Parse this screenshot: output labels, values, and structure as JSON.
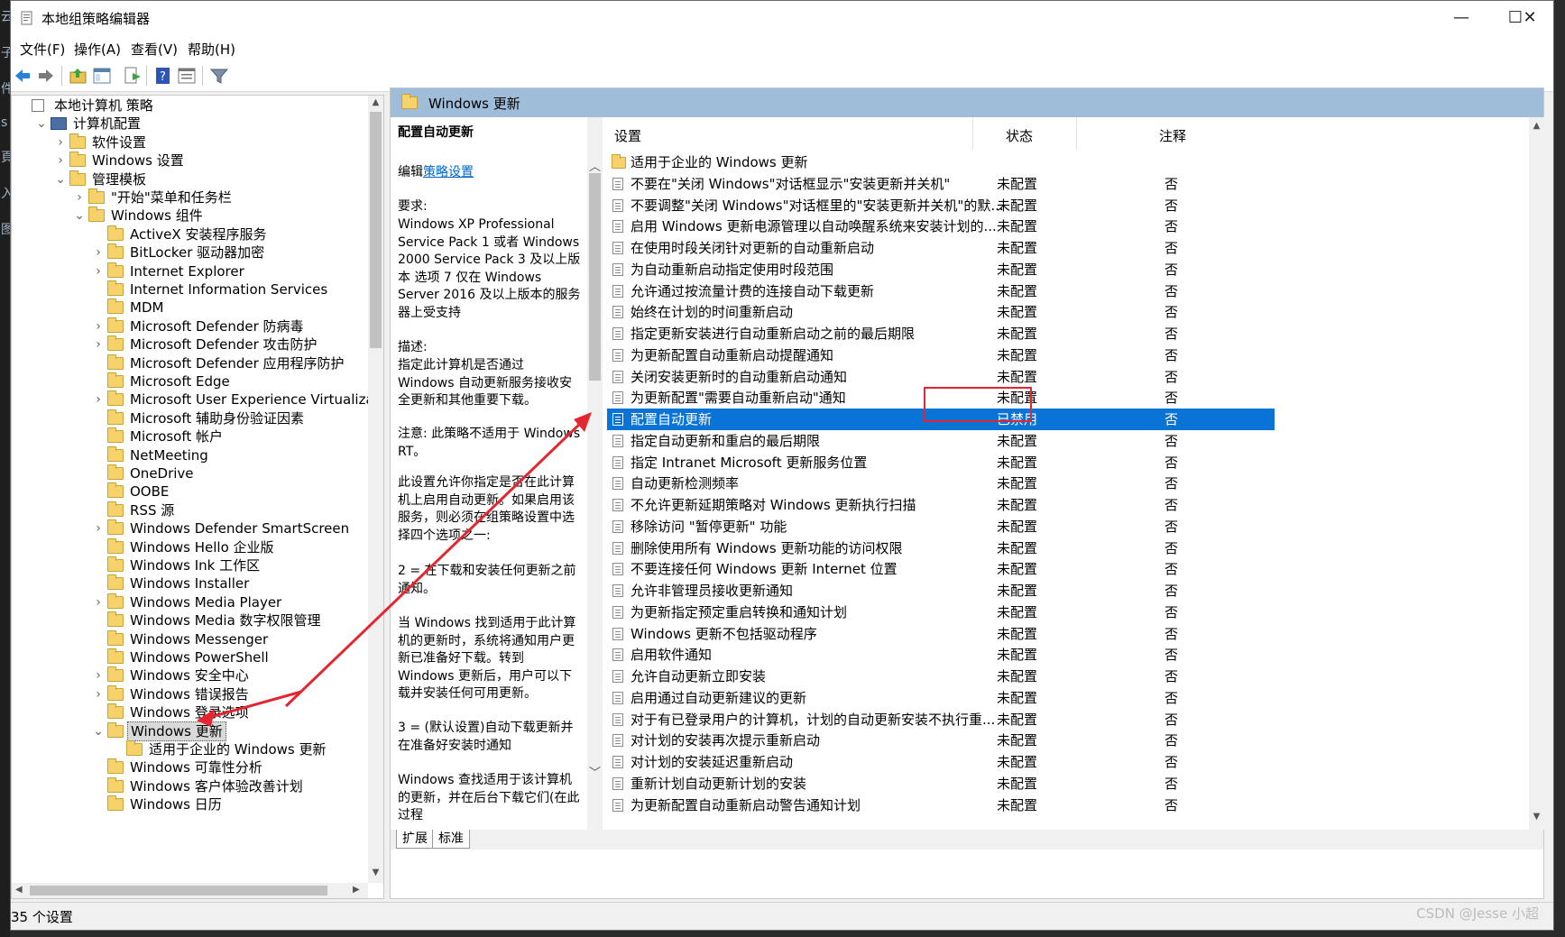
{
  "desktop_strip": [
    "云",
    "子",
    "件",
    "s",
    "頁",
    "入",
    "图"
  ],
  "window": {
    "title": "本地组策略编辑器",
    "controls": {
      "minimize": "—",
      "maximize": "☐",
      "close": "✕"
    }
  },
  "menu": [
    "文件(F)",
    "操作(A)",
    "查看(V)",
    "帮助(H)"
  ],
  "tree": {
    "items": [
      {
        "label": "本地计算机 策略",
        "level": 0,
        "expander": "",
        "icon": "policy"
      },
      {
        "label": "计算机配置",
        "level": 1,
        "expander": "v",
        "icon": "computer"
      },
      {
        "label": "软件设置",
        "level": 2,
        "expander": ">",
        "icon": "folder"
      },
      {
        "label": "Windows 设置",
        "level": 2,
        "expander": ">",
        "icon": "folder"
      },
      {
        "label": "管理模板",
        "level": 2,
        "expander": "v",
        "icon": "folder"
      },
      {
        "label": "\"开始\"菜单和任务栏",
        "level": 3,
        "expander": ">",
        "icon": "folder"
      },
      {
        "label": "Windows 组件",
        "level": 3,
        "expander": "v",
        "icon": "folder"
      },
      {
        "label": "ActiveX 安装程序服务",
        "level": 4,
        "expander": "",
        "icon": "folder"
      },
      {
        "label": "BitLocker 驱动器加密",
        "level": 4,
        "expander": ">",
        "icon": "folder"
      },
      {
        "label": "Internet Explorer",
        "level": 4,
        "expander": ">",
        "icon": "folder"
      },
      {
        "label": "Internet Information Services",
        "level": 4,
        "expander": "",
        "icon": "folder"
      },
      {
        "label": "MDM",
        "level": 4,
        "expander": "",
        "icon": "folder"
      },
      {
        "label": "Microsoft Defender 防病毒",
        "level": 4,
        "expander": ">",
        "icon": "folder"
      },
      {
        "label": "Microsoft Defender 攻击防护",
        "level": 4,
        "expander": ">",
        "icon": "folder"
      },
      {
        "label": "Microsoft Defender 应用程序防护",
        "level": 4,
        "expander": "",
        "icon": "folder"
      },
      {
        "label": "Microsoft Edge",
        "level": 4,
        "expander": "",
        "icon": "folder"
      },
      {
        "label": "Microsoft User Experience Virtualization",
        "level": 4,
        "expander": ">",
        "icon": "folder"
      },
      {
        "label": "Microsoft 辅助身份验证因素",
        "level": 4,
        "expander": "",
        "icon": "folder"
      },
      {
        "label": "Microsoft 帐户",
        "level": 4,
        "expander": "",
        "icon": "folder"
      },
      {
        "label": "NetMeeting",
        "level": 4,
        "expander": "",
        "icon": "folder"
      },
      {
        "label": "OneDrive",
        "level": 4,
        "expander": "",
        "icon": "folder"
      },
      {
        "label": "OOBE",
        "level": 4,
        "expander": "",
        "icon": "folder"
      },
      {
        "label": "RSS 源",
        "level": 4,
        "expander": "",
        "icon": "folder"
      },
      {
        "label": "Windows Defender SmartScreen",
        "level": 4,
        "expander": ">",
        "icon": "folder"
      },
      {
        "label": "Windows Hello 企业版",
        "level": 4,
        "expander": "",
        "icon": "folder"
      },
      {
        "label": "Windows Ink 工作区",
        "level": 4,
        "expander": "",
        "icon": "folder"
      },
      {
        "label": "Windows Installer",
        "level": 4,
        "expander": "",
        "icon": "folder"
      },
      {
        "label": "Windows Media Player",
        "level": 4,
        "expander": ">",
        "icon": "folder"
      },
      {
        "label": "Windows Media 数字权限管理",
        "level": 4,
        "expander": "",
        "icon": "folder"
      },
      {
        "label": "Windows Messenger",
        "level": 4,
        "expander": "",
        "icon": "folder"
      },
      {
        "label": "Windows PowerShell",
        "level": 4,
        "expander": "",
        "icon": "folder"
      },
      {
        "label": "Windows 安全中心",
        "level": 4,
        "expander": ">",
        "icon": "folder"
      },
      {
        "label": "Windows 错误报告",
        "level": 4,
        "expander": ">",
        "icon": "folder"
      },
      {
        "label": "Windows 登录选项",
        "level": 4,
        "expander": "",
        "icon": "folder"
      },
      {
        "label": "Windows 更新",
        "level": 4,
        "expander": "v",
        "icon": "folder",
        "selected": true
      },
      {
        "label": "适用于企业的 Windows 更新",
        "level": 5,
        "expander": "",
        "icon": "folder"
      },
      {
        "label": "Windows 可靠性分析",
        "level": 4,
        "expander": "",
        "icon": "folder"
      },
      {
        "label": "Windows 客户体验改善计划",
        "level": 4,
        "expander": "",
        "icon": "folder"
      },
      {
        "label": "Windows 日历",
        "level": 4,
        "expander": "",
        "icon": "folder"
      }
    ]
  },
  "right": {
    "header_title": "Windows 更新",
    "description": {
      "heading": "配置自动更新",
      "edit_prefix": "编辑",
      "edit_link": "策略设置",
      "req_label": "要求:",
      "req_text": "Windows XP Professional Service Pack 1 或者 Windows 2000 Service Pack 3 及以上版本 选项 7 仅在 Windows Server 2016 及以上版本的服务器上受支持",
      "desc_label": "描述:",
      "desc_text": "指定此计算机是否通过 Windows 自动更新服务接收安全更新和其他重要下载。",
      "note_text": "注意: 此策略不适用于 Windows RT。",
      "p1": "此设置允许你指定是否在此计算机上启用自动更新。如果启用该服务，则必须在组策略设置中选择四个选项之一:",
      "p2": "2 = 在下载和安装任何更新之前通知。",
      "p3": "当 Windows 找到适用于此计算机的更新时，系统将通知用户更新已准备好下载。转到 Windows 更新后，用户可以下载并安装任何可用更新。",
      "p4": "3 = (默认设置)自动下载更新并在准备好安装时通知",
      "p5": "Windows 查找适用于该计算机的更新，并在后台下载它们(在此过程"
    },
    "columns": {
      "setting": "设置",
      "state": "状态",
      "note": "注释"
    },
    "rows": [
      {
        "name": "适用于企业的 Windows 更新",
        "state": "",
        "note": "",
        "folder": true
      },
      {
        "name": "不要在\"关闭 Windows\"对话框显示\"安装更新并关机\"",
        "state": "未配置",
        "note": "否"
      },
      {
        "name": "不要调整\"关闭 Windows\"对话框里的\"安装更新并关机\"的默...",
        "state": "未配置",
        "note": "否"
      },
      {
        "name": "启用 Windows 更新电源管理以自动唤醒系统来安装计划的...",
        "state": "未配置",
        "note": "否"
      },
      {
        "name": "在使用时段关闭针对更新的自动重新启动",
        "state": "未配置",
        "note": "否"
      },
      {
        "name": "为自动重新启动指定使用时段范围",
        "state": "未配置",
        "note": "否"
      },
      {
        "name": "允许通过按流量计费的连接自动下载更新",
        "state": "未配置",
        "note": "否"
      },
      {
        "name": "始终在计划的时间重新启动",
        "state": "未配置",
        "note": "否"
      },
      {
        "name": "指定更新安装进行自动重新启动之前的最后期限",
        "state": "未配置",
        "note": "否"
      },
      {
        "name": "为更新配置自动重新启动提醒通知",
        "state": "未配置",
        "note": "否"
      },
      {
        "name": "关闭安装更新时的自动重新启动通知",
        "state": "未配置",
        "note": "否"
      },
      {
        "name": "为更新配置\"需要自动重新启动\"通知",
        "state": "未配置",
        "note": "否"
      },
      {
        "name": "配置自动更新",
        "state": "已禁用",
        "note": "否",
        "selected": true
      },
      {
        "name": "指定自动更新和重启的最后期限",
        "state": "未配置",
        "note": "否"
      },
      {
        "name": "指定 Intranet Microsoft 更新服务位置",
        "state": "未配置",
        "note": "否"
      },
      {
        "name": "自动更新检测频率",
        "state": "未配置",
        "note": "否"
      },
      {
        "name": "不允许更新延期策略对 Windows 更新执行扫描",
        "state": "未配置",
        "note": "否"
      },
      {
        "name": "移除访问 \"暂停更新\" 功能",
        "state": "未配置",
        "note": "否"
      },
      {
        "name": "删除使用所有 Windows 更新功能的访问权限",
        "state": "未配置",
        "note": "否"
      },
      {
        "name": "不要连接任何 Windows 更新 Internet 位置",
        "state": "未配置",
        "note": "否"
      },
      {
        "name": "允许非管理员接收更新通知",
        "state": "未配置",
        "note": "否"
      },
      {
        "name": "为更新指定预定重启转换和通知计划",
        "state": "未配置",
        "note": "否"
      },
      {
        "name": "Windows 更新不包括驱动程序",
        "state": "未配置",
        "note": "否"
      },
      {
        "name": "启用软件通知",
        "state": "未配置",
        "note": "否"
      },
      {
        "name": "允许自动更新立即安装",
        "state": "未配置",
        "note": "否"
      },
      {
        "name": "启用通过自动更新建议的更新",
        "state": "未配置",
        "note": "否"
      },
      {
        "name": "对于有已登录用户的计算机，计划的自动更新安装不执行重...",
        "state": "未配置",
        "note": "否"
      },
      {
        "name": "对计划的安装再次提示重新启动",
        "state": "未配置",
        "note": "否"
      },
      {
        "name": "对计划的安装延迟重新启动",
        "state": "未配置",
        "note": "否"
      },
      {
        "name": "重新计划自动更新计划的安装",
        "state": "未配置",
        "note": "否"
      },
      {
        "name": "为更新配置自动重新启动警告通知计划",
        "state": "未配置",
        "note": "否"
      }
    ],
    "tabs": [
      "扩展",
      "标准"
    ]
  },
  "status": {
    "text": "35 个设置"
  },
  "watermark": "CSDN @Jesse 小超",
  "colors": {
    "selection": "#0a74d6",
    "header": "#9fbcd9",
    "annotation": "#e3262f",
    "link": "#0066cc"
  }
}
